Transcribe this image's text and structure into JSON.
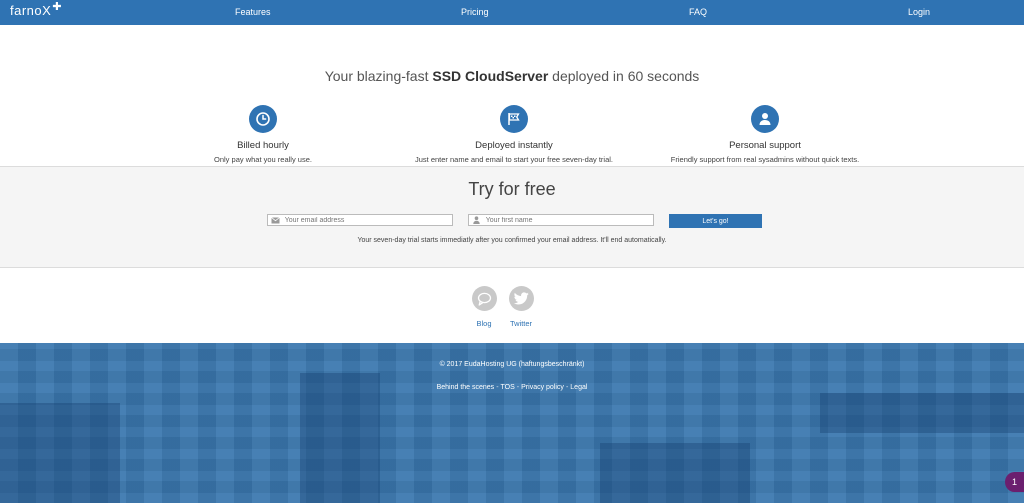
{
  "nav": {
    "logo": "farnoX",
    "links": [
      "Features",
      "Pricing",
      "FAQ",
      "Login"
    ]
  },
  "hero": {
    "tagline_pre": "Your blazing-fast ",
    "tagline_bold": "SSD CloudServer",
    "tagline_post": " deployed in 60 seconds",
    "features": [
      {
        "icon": "clock-icon",
        "title": "Billed hourly",
        "desc": "Only pay what you really use."
      },
      {
        "icon": "flag-icon",
        "title": "Deployed instantly",
        "desc": "Just enter name and email to start your free seven-day trial."
      },
      {
        "icon": "user-icon",
        "title": "Personal support",
        "desc": "Friendly support from real sysadmins without quick texts."
      }
    ]
  },
  "trial": {
    "title": "Try for free",
    "email_placeholder": "Your email address",
    "name_placeholder": "Your first name",
    "button": "Let's go!",
    "note": "Your seven-day trial starts immediatly after you confirmed your email address. It'll end automatically."
  },
  "social": [
    {
      "icon": "chat-bubble-icon",
      "label": "Blog"
    },
    {
      "icon": "twitter-icon",
      "label": "Twitter"
    }
  ],
  "footer": {
    "copyright": "© 2017 EudaHosting UG (haftungsbeschränkt)",
    "links": [
      "Behind the scenes",
      "TOS",
      "Privacy policy",
      "Legal"
    ]
  },
  "badge": "1",
  "colors": {
    "brand": "#2f73b3",
    "footer": "#3a77ae",
    "badge": "#6b1f6f"
  }
}
